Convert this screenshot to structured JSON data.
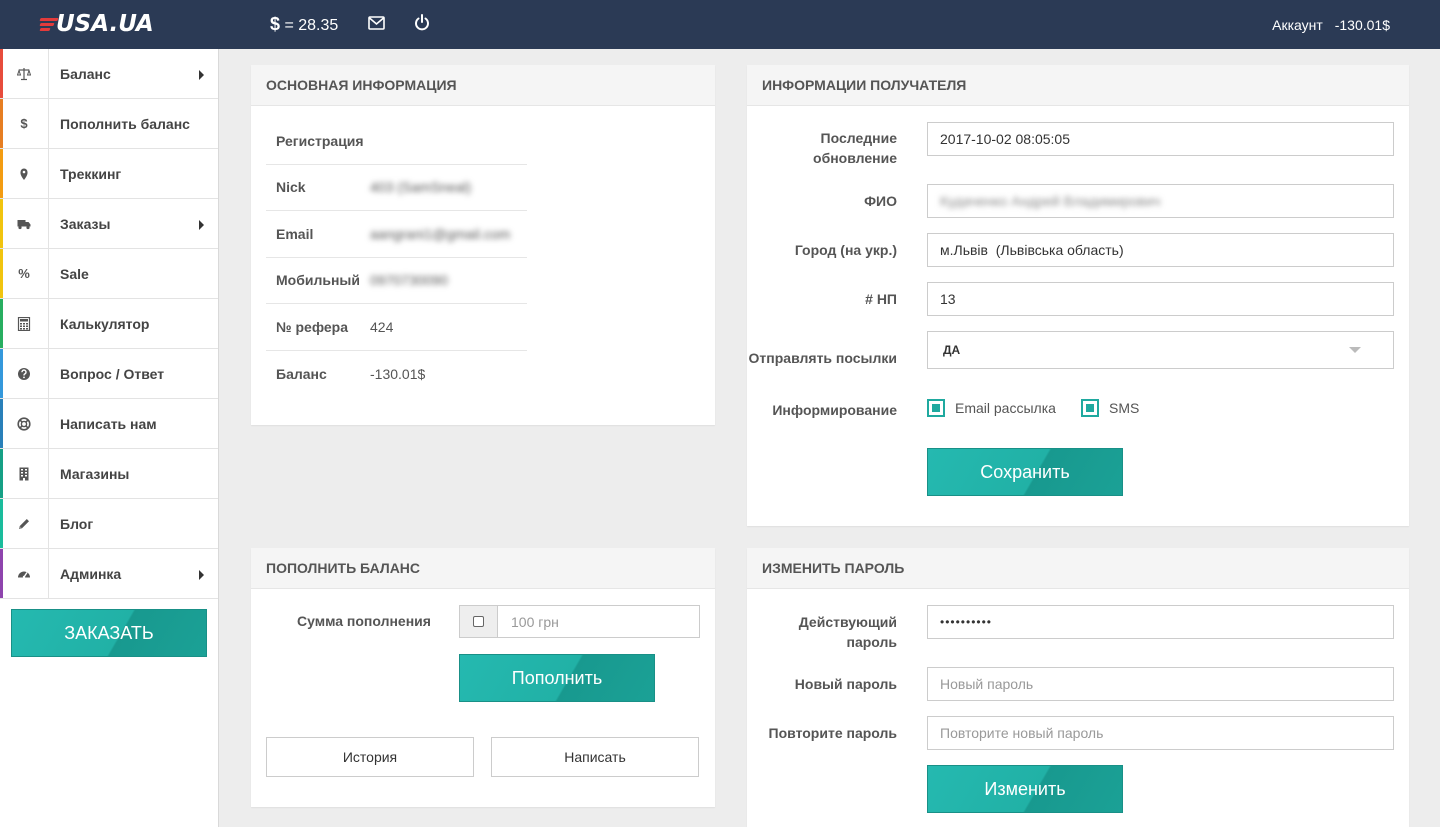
{
  "header": {
    "logo": "USA.UA",
    "rate_symbol": "$",
    "rate_text": "= 28.35",
    "account_label": "Аккаунт",
    "account_balance": "-130.01$"
  },
  "sidebar": {
    "items": [
      {
        "label": "Баланс",
        "icon": "scales-icon",
        "has_submenu": true,
        "color": "#e74c3c"
      },
      {
        "label": "Пополнить баланс",
        "icon": "dollar-icon",
        "has_submenu": false,
        "color": "#e67e22"
      },
      {
        "label": "Треккинг",
        "icon": "map-pin-icon",
        "has_submenu": false,
        "color": "#f39c12"
      },
      {
        "label": "Заказы",
        "icon": "truck-icon",
        "has_submenu": true,
        "color": "#f1c40f"
      },
      {
        "label": "Sale",
        "icon": "percent-icon",
        "has_submenu": false,
        "color": "#f1c40f"
      },
      {
        "label": "Калькулятор",
        "icon": "calculator-icon",
        "has_submenu": false,
        "color": "#27ae60"
      },
      {
        "label": "Вопрос / Ответ",
        "icon": "question-icon",
        "has_submenu": false,
        "color": "#3498db"
      },
      {
        "label": "Написать нам",
        "icon": "lifebuoy-icon",
        "has_submenu": false,
        "color": "#2980b9"
      },
      {
        "label": "Магазины",
        "icon": "building-icon",
        "has_submenu": false,
        "color": "#16a085"
      },
      {
        "label": "Блог",
        "icon": "pencil-icon",
        "has_submenu": false,
        "color": "#1abc9c"
      },
      {
        "label": "Админка",
        "icon": "dashboard-icon",
        "has_submenu": true,
        "color": "#8e44ad"
      }
    ],
    "order_button": "ЗАКАЗАТЬ",
    "symbols": {
      "dollar": "$",
      "percent": "%"
    }
  },
  "basic_info": {
    "title": "ОСНОВНАЯ ИНФОРМАЦИЯ",
    "rows": [
      {
        "label": "Регистрация",
        "value": ""
      },
      {
        "label": "Nick",
        "value": "403 (SamSneal)"
      },
      {
        "label": "Email",
        "value": "aangrani1@gmail.com"
      },
      {
        "label": "Мобильный",
        "value": "0970730090"
      },
      {
        "label": "№ рефера",
        "value": "424"
      },
      {
        "label": "Баланс",
        "value": "-130.01$"
      }
    ]
  },
  "recipient": {
    "title": "ИНФОРМАЦИИ ПОЛУЧАТЕЛЯ",
    "last_update_label": "Последние обновление",
    "last_update_value": "2017-10-02 08:05:05",
    "fio_label": "ФИО",
    "fio_value": "Кудаченко Андрей Владимирович",
    "city_label": "Город (на укр.)",
    "city_value": "м.Львів  (Львівська область)",
    "np_label": "# НП",
    "np_value": "13",
    "send_label": "Отправлять посылки",
    "send_value": "ДА",
    "inform_label": "Информирование",
    "email_opt": "Email рассылка",
    "sms_opt": "SMS",
    "save_button": "Сохранить"
  },
  "topup": {
    "title": "ПОПОЛНИТЬ БАЛАНС",
    "amount_label": "Сумма пополнения",
    "amount_placeholder": "100 грн",
    "topup_button": "Пополнить",
    "history_button": "История",
    "write_button": "Написать"
  },
  "password": {
    "title": "ИЗМЕНИТЬ ПАРОЛЬ",
    "current_label": "Действующий пароль",
    "current_value": "••••••••••",
    "new_label": "Новый пароль",
    "new_placeholder": "Новый пароль",
    "repeat_label": "Повторите пароль",
    "repeat_placeholder": "Повторите новый пароль",
    "change_button": "Изменить"
  }
}
